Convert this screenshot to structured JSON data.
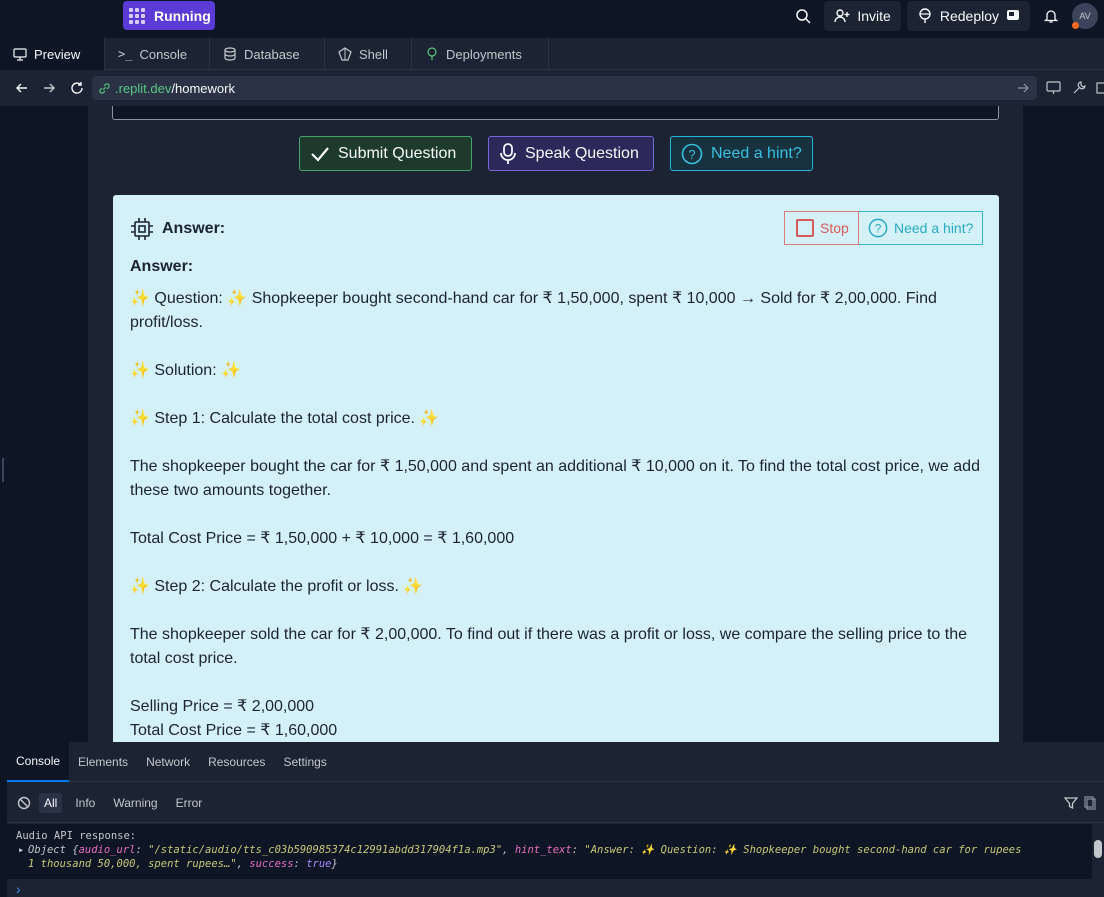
{
  "topbar": {
    "run_label": "Running",
    "invite_label": "Invite",
    "redeploy_label": "Redeploy",
    "avatar_initials": "AV"
  },
  "tabs": [
    "Preview",
    "Console",
    "Database",
    "Shell",
    "Deployments"
  ],
  "url": {
    "host": ".replit.dev",
    "path": "/homework"
  },
  "actions": {
    "submit": "Submit Question",
    "speak": "Speak Question",
    "hint": "Need a hint?"
  },
  "answer_card": {
    "heading": "Answer:",
    "stop": "Stop",
    "hint": "Need a hint?",
    "lines": {
      "title": "Answer:",
      "question_label": "Question:",
      "question_text": "Shopkeeper bought second-hand car for ₹ 1,50,000, spent ₹ 10,000 → Sold for ₹ 2,00,000. Find profit/loss.",
      "solution": "Solution:",
      "step1": "Step 1: Calculate the total cost price.",
      "p1": "The shopkeeper bought the car for ₹ 1,50,000 and spent an additional ₹ 10,000 on it. To find the total cost price, we add these two amounts together.",
      "total_cost": "Total Cost Price = ₹ 1,50,000 + ₹ 10,000 = ₹ 1,60,000",
      "step2": "Step 2: Calculate the profit or loss.",
      "p2": "The shopkeeper sold the car for ₹ 2,00,000. To find out if there was a profit or loss, we compare the selling price to the total cost price.",
      "selling": "Selling Price = ₹ 2,00,000",
      "total_cost2": "Total Cost Price = ₹ 1,60,000"
    }
  },
  "devtools": {
    "tabs": [
      "Console",
      "Elements",
      "Network",
      "Resources",
      "Settings"
    ],
    "filters": [
      "All",
      "Info",
      "Warning",
      "Error"
    ],
    "log_title": "Audio API response:",
    "log_prefix": "Object {",
    "key_audio": "audio_url",
    "val_audio": "\"/static/audio/tts_c03b590985374c12991abdd317904f1a.mp3\"",
    "key_hint": "hint_text",
    "val_hint_a": "\"Answer: ✨ Question: ✨ Shopkeeper bought second-hand car for rupees",
    "val_hint_b": "1 thousand 50,000, spent rupees…\"",
    "key_success": "success",
    "val_success": "true",
    "log_suffix": "}"
  }
}
